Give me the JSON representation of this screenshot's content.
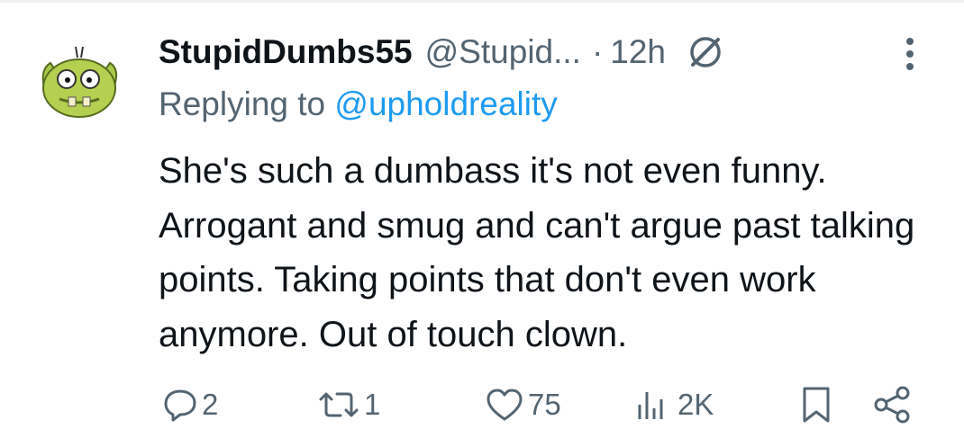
{
  "post": {
    "author_name": "StupidDumbs55",
    "author_handle": "@Stupid...",
    "separator": "·",
    "time": "12h",
    "replying_prefix": "Replying to ",
    "replying_to": "@upholdreality",
    "text": "She's such a dumbass it's not even funny. Arrogant and smug and can't argue past talking points. Taking points that don't even work anymore. Out of touch clown."
  },
  "actions": {
    "replies": "2",
    "reposts": "1",
    "likes": "75",
    "views": "2K"
  },
  "icons": [
    "avatar",
    "grok-icon",
    "more-icon",
    "reply-icon",
    "repost-icon",
    "like-icon",
    "views-icon",
    "bookmark-icon",
    "share-icon"
  ],
  "colors": {
    "text": "#0f1419",
    "secondary": "#536471",
    "link": "#1d9bf0"
  }
}
